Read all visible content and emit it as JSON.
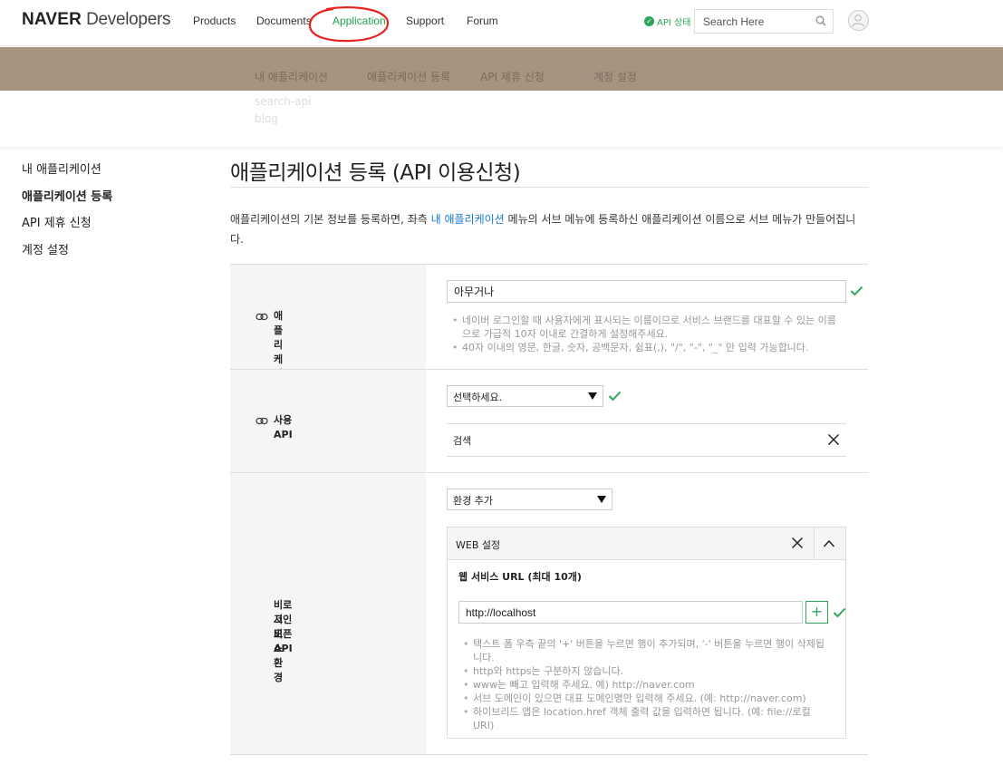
{
  "header": {
    "logo_bold": "NAVER",
    "logo_light": " Developers",
    "nav": [
      "Products",
      "Documents",
      "Application",
      "Support",
      "Forum"
    ],
    "active_nav": "Application",
    "api_status": "API 상태",
    "search_placeholder": "Search Here"
  },
  "band_menu": [
    "내 애플리케이션",
    "애플리케이션 등록",
    "API 제휴 신청",
    "계정 설정"
  ],
  "band_submenu": [
    "search-api",
    "blog"
  ],
  "sidebar": {
    "items": [
      "내 애플리케이션",
      "애플리케이션 등록",
      "API 제휴 신청",
      "계정 설정"
    ],
    "active": "애플리케이션 등록"
  },
  "main": {
    "title": "애플리케이션 등록 (API 이용신청)",
    "desc_before": "애플리케이션의 기본 정보를 등록하면, 좌측 ",
    "desc_link": "내 애플리케이션",
    "desc_after": " 메뉴의 서브 메뉴에 등록하신 애플리케이션 이름으로 서브 메뉴가 만들어집니다."
  },
  "form": {
    "app_name": {
      "label": "애플리케이션 이름",
      "value": "아무거나",
      "notes": [
        "네이버 로그인할 때 사용자에게 표시되는 이름이므로 서비스 브랜드를 대표할 수 있는 이름으로 가급적 10자 이내로 간결하게 설정해주세요.",
        "40자 이내의 영문, 한글, 숫자, 공백문자, 쉼표(,), \"/\", \"-\", \"_\" 만 입력 가능합니다."
      ]
    },
    "api": {
      "label": "사용 API",
      "select_value": "선택하세요.",
      "selected_api": "검색"
    },
    "env": {
      "label_line1": "비로그인 오픈 API",
      "label_line2": "서비스 환경",
      "select_value": "환경 추가",
      "panel_title": "WEB 설정",
      "url_label": "웹 서비스 URL (최대 10개)",
      "url_value": "http://localhost",
      "notes": [
        "텍스트 폼 우측 끝의 '+' 버튼을 누르면 행이 추가되며, '-' 버튼을 누르면 행이 삭제됩니다.",
        "http와 https는 구분하지 않습니다.",
        "www는 빼고 입력해 주세요. 예) http://naver.com",
        "서브 도메인이 있으면 대표 도메인명만 입력해 주세요. (예: http://naver.com)",
        "하이브리드 앱은 location.href 객체 출력 값을 입력하면 됩니다. (예: file://로컬URI)"
      ]
    }
  },
  "colors": {
    "accent": "#2ca55a",
    "band": "#a8937f",
    "link": "#1a7bd6",
    "annotation": "#e8231f"
  }
}
